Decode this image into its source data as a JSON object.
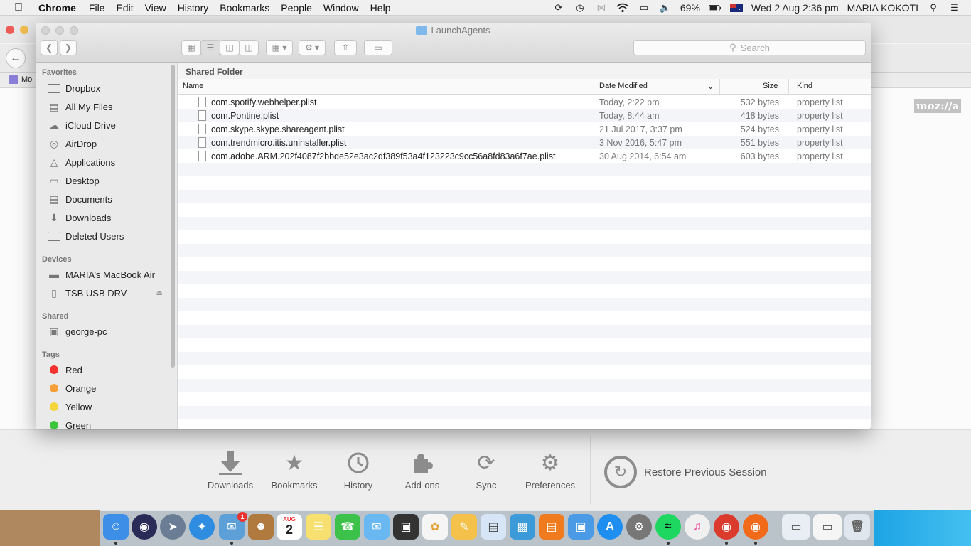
{
  "menubar": {
    "app_name": "Chrome",
    "menus": [
      "File",
      "Edit",
      "View",
      "History",
      "Bookmarks",
      "People",
      "Window",
      "Help"
    ],
    "battery": "69%",
    "datetime": "Wed 2 Aug  2:36 pm",
    "user": "MARIA KOKOTI"
  },
  "firefox": {
    "bookmark_label": "Mo",
    "logo_text": "moz://a",
    "launcher": [
      {
        "label": "Downloads",
        "icon": "download-icon"
      },
      {
        "label": "Bookmarks",
        "icon": "star-icon"
      },
      {
        "label": "History",
        "icon": "clock-icon"
      },
      {
        "label": "Add-ons",
        "icon": "puzzle-icon"
      },
      {
        "label": "Sync",
        "icon": "sync-icon"
      },
      {
        "label": "Preferences",
        "icon": "gear-icon"
      }
    ],
    "restore_label": "Restore Previous Session"
  },
  "finder": {
    "title": "LaunchAgents",
    "search_placeholder": "Search",
    "path_header": "Shared Folder",
    "columns": {
      "name": "Name",
      "date": "Date Modified",
      "size": "Size",
      "kind": "Kind"
    },
    "sidebar": {
      "favorites_heading": "Favorites",
      "favorites": [
        {
          "label": "Dropbox",
          "icon": "folder-icon"
        },
        {
          "label": "All My Files",
          "icon": "files-icon"
        },
        {
          "label": "iCloud Drive",
          "icon": "cloud-icon"
        },
        {
          "label": "AirDrop",
          "icon": "airdrop-icon"
        },
        {
          "label": "Applications",
          "icon": "applications-icon"
        },
        {
          "label": "Desktop",
          "icon": "desktop-icon"
        },
        {
          "label": "Documents",
          "icon": "document-icon"
        },
        {
          "label": "Downloads",
          "icon": "download-icon"
        },
        {
          "label": "Deleted Users",
          "icon": "folder-icon"
        }
      ],
      "devices_heading": "Devices",
      "devices": [
        {
          "label": "MARIA’s MacBook Air",
          "icon": "laptop-icon"
        },
        {
          "label": "TSB USB DRV",
          "icon": "drive-icon"
        }
      ],
      "shared_heading": "Shared",
      "shared": [
        {
          "label": "george-pc",
          "icon": "monitor-icon"
        }
      ],
      "tags_heading": "Tags",
      "tags": [
        {
          "label": "Red",
          "color": "#f3322f"
        },
        {
          "label": "Orange",
          "color": "#f7a03a"
        },
        {
          "label": "Yellow",
          "color": "#f5d63a"
        },
        {
          "label": "Green",
          "color": "#3ec43b"
        }
      ]
    },
    "files": [
      {
        "name": "com.spotify.webhelper.plist",
        "date": "Today, 2:22 pm",
        "size": "532 bytes",
        "kind": "property list"
      },
      {
        "name": "com.Pontine.plist",
        "date": "Today, 8:44 am",
        "size": "418 bytes",
        "kind": "property list"
      },
      {
        "name": "com.skype.skype.shareagent.plist",
        "date": "21 Jul 2017, 3:37 pm",
        "size": "524 bytes",
        "kind": "property list"
      },
      {
        "name": "com.trendmicro.itis.uninstaller.plist",
        "date": "3 Nov 2016, 5:47 pm",
        "size": "551 bytes",
        "kind": "property list"
      },
      {
        "name": "com.adobe.ARM.202f4087f2bbde52e3ac2df389f53a4f123223c9cc56a8fd83a6f7ae.plist",
        "date": "30 Aug 2014, 6:54 am",
        "size": "603 bytes",
        "kind": "property list"
      }
    ]
  },
  "dock": {
    "calendar_day": "2",
    "calendar_month": "AUG",
    "mail_badge": "1"
  }
}
